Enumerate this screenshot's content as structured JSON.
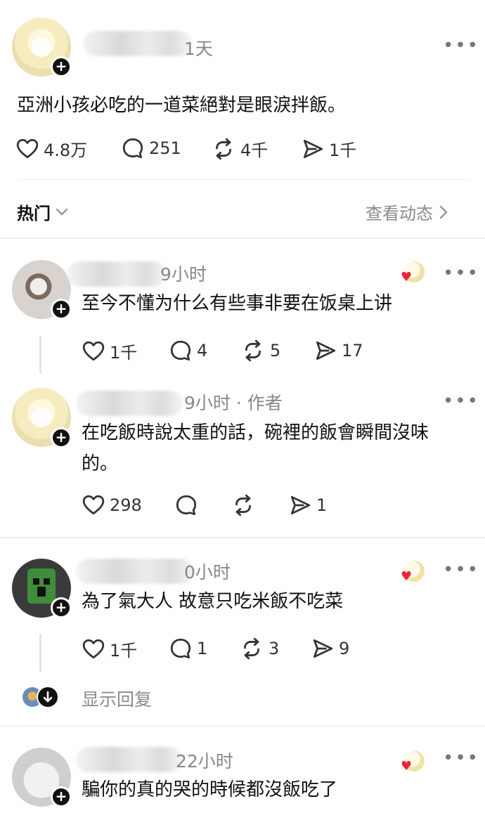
{
  "post": {
    "time": "1天",
    "text": "亞洲小孩必吃的一道菜絕對是眼淚拌飯。",
    "likes": "4.8万",
    "comments": "251",
    "reposts": "4千",
    "shares": "1千"
  },
  "sort": {
    "label": "热门",
    "view_activity": "查看动态"
  },
  "replies": [
    {
      "time": "9小时",
      "text": "至今不懂为什么有些事非要在饭桌上讲",
      "likes": "1千",
      "comments": "4",
      "reposts": "5",
      "shares": "17"
    },
    {
      "time": "9小时 · 作者",
      "text_line1": "在吃飯時說太重的話，碗裡的飯會瞬間沒味",
      "text_line2": "的。",
      "likes": "298",
      "comments": "",
      "reposts": "",
      "shares": "1"
    },
    {
      "time": "0小时",
      "text": "為了氣大人 故意只吃米飯不吃菜",
      "likes": "1千",
      "comments": "1",
      "reposts": "3",
      "shares": "9",
      "show_replies": "显示回复"
    },
    {
      "time": "22小时",
      "text": "騙你的真的哭的時候都沒飯吃了"
    }
  ],
  "icons": {
    "more": "more-icon",
    "heart": "heart-icon",
    "comment": "comment-icon",
    "repost": "repost-icon",
    "share": "share-icon",
    "follow": "plus-icon",
    "chevron": "chevron-icon"
  },
  "colors": {
    "text": "#111111",
    "muted": "#888888",
    "liked_heart": "#e8243c"
  }
}
